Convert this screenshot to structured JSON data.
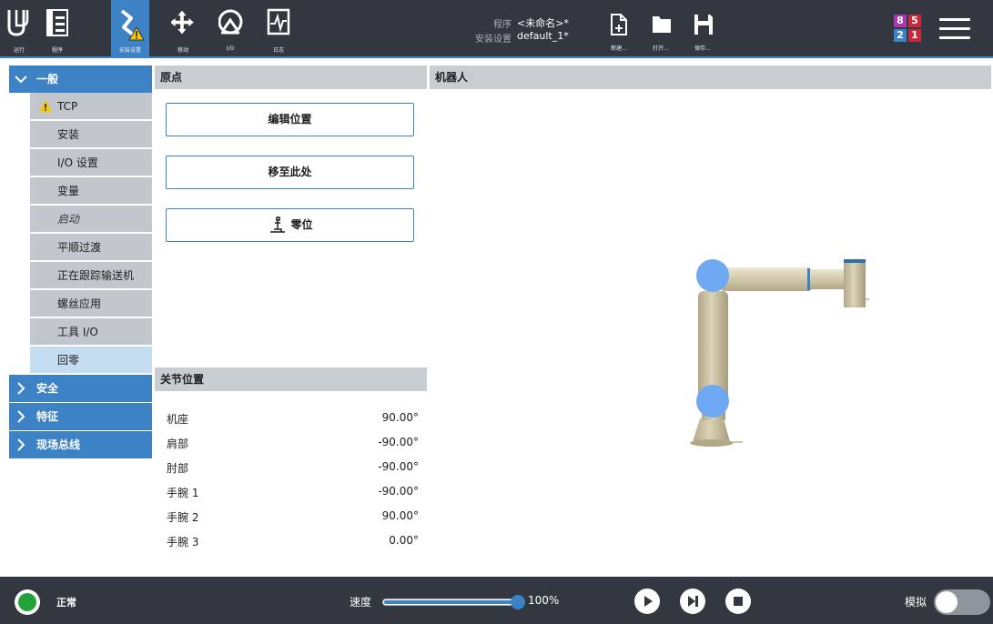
{
  "header": {
    "nav": [
      {
        "id": "run",
        "label": "运行",
        "icon": "ur-logo-icon"
      },
      {
        "id": "program",
        "label": "程序",
        "icon": "program-tree-icon"
      },
      {
        "id": "installation",
        "label": "安装设置",
        "icon": "installation-warning-icon",
        "active": true
      },
      {
        "id": "move",
        "label": "移动",
        "icon": "move-arrows-icon"
      },
      {
        "id": "io",
        "label": "I/O",
        "icon": "io-icon"
      },
      {
        "id": "log",
        "label": "日志",
        "icon": "log-icon"
      }
    ],
    "program_label": "程序",
    "program_value": "<未命名>*",
    "installation_label": "安装设置",
    "installation_value": "default_1*",
    "file_actions": [
      {
        "id": "new",
        "label": "新建...",
        "icon": "new-file-icon"
      },
      {
        "id": "open",
        "label": "打开...",
        "icon": "open-folder-icon"
      },
      {
        "id": "save",
        "label": "保存...",
        "icon": "save-icon"
      }
    ],
    "counter": {
      "tl": "8",
      "tr": "5",
      "bl": "2",
      "br": "1"
    }
  },
  "tree": {
    "sections": [
      {
        "id": "general",
        "label": "一般",
        "expanded": true
      },
      {
        "id": "safety",
        "label": "安全",
        "expanded": false
      },
      {
        "id": "features",
        "label": "特征",
        "expanded": false
      },
      {
        "id": "fieldbus",
        "label": "现场总线",
        "expanded": false
      }
    ],
    "general_items": [
      {
        "label": "TCP",
        "warning": true
      },
      {
        "label": "安装"
      },
      {
        "label": "I/O 设置"
      },
      {
        "label": "变量"
      },
      {
        "label": "启动",
        "italic": true
      },
      {
        "label": "平顺过渡"
      },
      {
        "label": "正在跟踪输送机"
      },
      {
        "label": "螺丝应用"
      },
      {
        "label": "工具 I/O"
      },
      {
        "label": "回零",
        "selected": true
      }
    ]
  },
  "home_panel": {
    "title": "原点",
    "edit_position": "编辑位置",
    "move_here": "移至此处",
    "zero_position": "零位"
  },
  "joint_panel": {
    "title": "关节位置",
    "joints": [
      {
        "name": "机座",
        "value": "90.00°"
      },
      {
        "name": "肩部",
        "value": "-90.00°"
      },
      {
        "name": "肘部",
        "value": "-90.00°"
      },
      {
        "name": "手腕 1",
        "value": "-90.00°"
      },
      {
        "name": "手腕 2",
        "value": "90.00°"
      },
      {
        "name": "手腕 3",
        "value": "0.00°"
      }
    ]
  },
  "robot_panel": {
    "title": "机器人"
  },
  "footer": {
    "status": "正常",
    "speed_label": "速度",
    "speed_percent": 100,
    "speed_value": "100%",
    "simulation_label": "模拟",
    "simulation_on": false
  },
  "colors": {
    "header_bg": "#33373f",
    "accent": "#3c82c4",
    "tree_item_bg": "#c2c7cd",
    "selected_item_bg": "#c5ddf0",
    "status_ok": "#21a33a",
    "warning": "#f5c800"
  }
}
